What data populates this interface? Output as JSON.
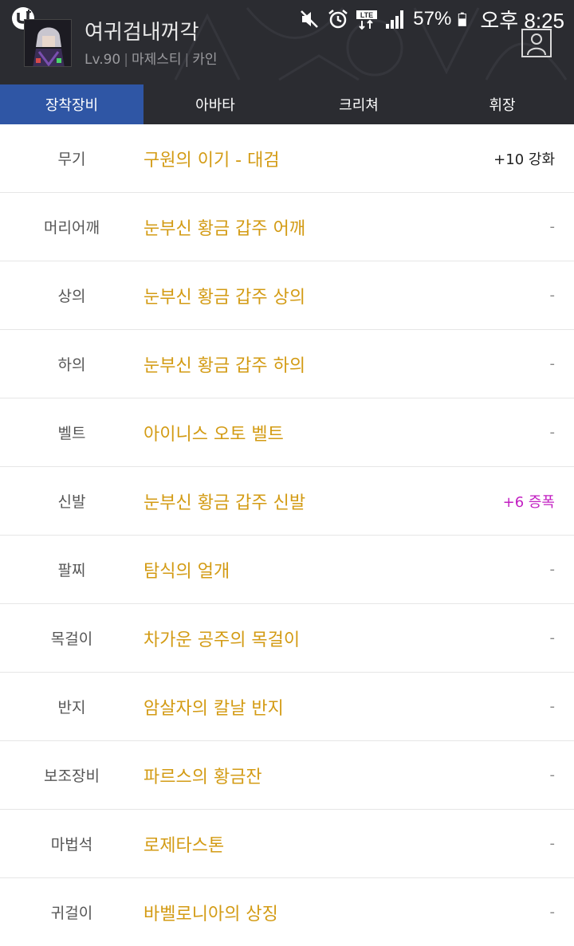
{
  "status_bar": {
    "battery": "57%",
    "time": "오후 8:25",
    "network": "LTE",
    "icons": [
      "carrier-u-plus-icon",
      "mute-icon",
      "alarm-icon",
      "lte-icon",
      "signal-icon",
      "battery-icon"
    ]
  },
  "character": {
    "name": "여귀검내꺼각",
    "level": "Lv.90",
    "job": "마제스티",
    "server": "카인",
    "separator": "|"
  },
  "tabs": [
    {
      "label": "장착장비",
      "active": true
    },
    {
      "label": "아바타",
      "active": false
    },
    {
      "label": "크리쳐",
      "active": false
    },
    {
      "label": "휘장",
      "active": false
    }
  ],
  "equipment": [
    {
      "slot": "무기",
      "item": "구원의 이기 - 대검",
      "upgrade": "+10 강화",
      "kind": "enhance"
    },
    {
      "slot": "머리어깨",
      "item": "눈부신 황금 갑주 어깨",
      "upgrade": "-",
      "kind": "none"
    },
    {
      "slot": "상의",
      "item": "눈부신 황금 갑주 상의",
      "upgrade": "-",
      "kind": "none"
    },
    {
      "slot": "하의",
      "item": "눈부신 황금 갑주 하의",
      "upgrade": "-",
      "kind": "none"
    },
    {
      "slot": "벨트",
      "item": "아이니스 오토 벨트",
      "upgrade": "-",
      "kind": "none"
    },
    {
      "slot": "신발",
      "item": "눈부신 황금 갑주 신발",
      "upgrade": "+6 증폭",
      "kind": "amplify"
    },
    {
      "slot": "팔찌",
      "item": "탐식의 얼개",
      "upgrade": "-",
      "kind": "none"
    },
    {
      "slot": "목걸이",
      "item": "차가운 공주의 목걸이",
      "upgrade": "-",
      "kind": "none"
    },
    {
      "slot": "반지",
      "item": "암살자의 칼날 반지",
      "upgrade": "-",
      "kind": "none"
    },
    {
      "slot": "보조장비",
      "item": "파르스의 황금잔",
      "upgrade": "-",
      "kind": "none"
    },
    {
      "slot": "마법석",
      "item": "로제타스톤",
      "upgrade": "-",
      "kind": "none"
    },
    {
      "slot": "귀걸이",
      "item": "바벨로니아의 상징",
      "upgrade": "-",
      "kind": "none"
    }
  ],
  "colors": {
    "header_bg": "#2b2c31",
    "active_tab": "#2f56a5",
    "item_name": "#d39b14",
    "amplify": "#c21fc2"
  }
}
